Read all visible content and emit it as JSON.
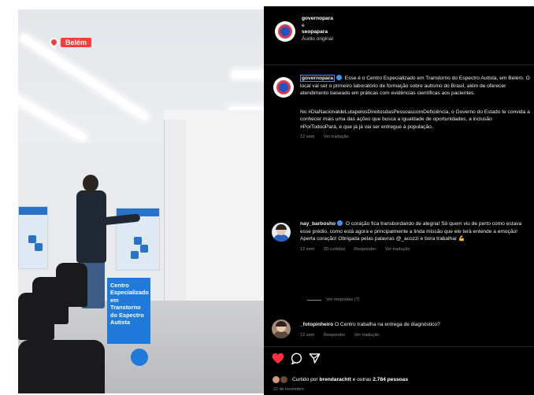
{
  "photo": {
    "location_tag": "Belém",
    "caption": "Centro Especializado em Transtorno do Espectro Autista"
  },
  "post_header": {
    "user1": "governopara",
    "separator": "e",
    "user2": "seopapara",
    "audio": "Áudio original"
  },
  "caption": {
    "username": "governopara",
    "body": "Esse é o Centro Especializado em Transtorno do Espectro Autista, em Belém. O local vai ser o primeiro laboratório de formação sobre autismo do Brasil, além de oferecer atendimento baseado em práticas com evidências científicas aos pacientes.",
    "hashtags": "No #DiaNacionaldeLutapelosDireitosdasPessoascomDeficiência, o Governo do Estado te convida a conhecer mais uma das ações que busca a igualdade de oportunidades, a inclusão #PorTodooPará, e que já já vai ser entregue à população.",
    "time": "12 sem",
    "translate": "Ver tradução"
  },
  "comments": [
    {
      "username": "nay_barbosho",
      "text": "O coração fica transbordando de alegria! Só quem viu de perto como estava esse prédio, como está agora e principalmente a linda missão que ele terá entende a emoção! Aperta coração! Obrigada pelas palavras @_acozzi e bora trabalhar 💪",
      "time": "12 sem",
      "likes": "20 curtidas",
      "reply": "Responder",
      "translate": "Ver tradução",
      "view_replies": "Ver respostas (7)"
    },
    {
      "username": "_fotopinheiro",
      "text": "O Centro trabalha na entrega de diagnóstico?",
      "time": "12 sem",
      "reply": "Responder",
      "translate": "Ver tradução"
    }
  ],
  "likes": {
    "prefix": "Curtido por",
    "user": "brendarachtt",
    "suffix": "e outras",
    "count": "2.784 pessoas"
  },
  "date": "22 de novembro",
  "colors": {
    "accent_blue": "#1f7ad9",
    "heart_red": "#ff3040",
    "panel_bg": "#000000"
  }
}
